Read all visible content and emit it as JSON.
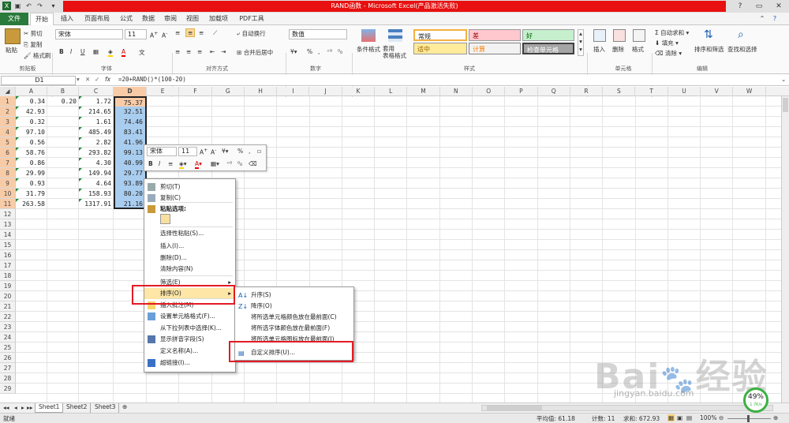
{
  "window": {
    "title": "RAND函数 - Microsoft Excel(产品激活失败)"
  },
  "tabs": [
    "文件",
    "开始",
    "插入",
    "页面布局",
    "公式",
    "数据",
    "审阅",
    "视图",
    "加载项",
    "PDF工具"
  ],
  "ribbon": {
    "clipboard": {
      "paste": "粘贴",
      "cut": "剪切",
      "copy": "复制",
      "format_painter": "格式刷",
      "group": "剪贴板"
    },
    "font": {
      "name": "宋体",
      "size": "11",
      "group": "字体"
    },
    "alignment": {
      "wrap": "自动换行",
      "merge": "合并后居中",
      "group": "对齐方式"
    },
    "number": {
      "format": "数值",
      "group": "数字"
    },
    "styles": {
      "conditional": "条件格式",
      "table": "套用\n表格格式",
      "normal": "常规",
      "bad": "差",
      "good": "好",
      "neutral": "适中",
      "calc": "计算",
      "check": "检查单元格",
      "group": "样式"
    },
    "cells": {
      "insert": "插入",
      "delete": "删除",
      "format": "格式",
      "group": "单元格"
    },
    "editing": {
      "autosum": "自动求和",
      "fill": "填充",
      "clear": "清除",
      "sort_filter": "排序和筛选",
      "find_select": "查找和选择",
      "group": "编辑"
    }
  },
  "formula_bar": {
    "name_box": "D1",
    "fx": "fx",
    "formula": "=20+RAND()*(100-20)"
  },
  "columns": [
    "A",
    "B",
    "C",
    "D",
    "E",
    "F",
    "G",
    "H",
    "I",
    "J",
    "K",
    "L",
    "M",
    "N",
    "O",
    "P",
    "Q",
    "R",
    "S",
    "T",
    "U",
    "V",
    "W"
  ],
  "rows": [
    "1",
    "2",
    "3",
    "4",
    "5",
    "6",
    "7",
    "8",
    "9",
    "10",
    "11",
    "12",
    "13",
    "14",
    "15",
    "16",
    "17",
    "18",
    "19",
    "20",
    "21",
    "22",
    "23",
    "24",
    "25",
    "26",
    "27",
    "28",
    "29"
  ],
  "cells": {
    "A": [
      "0.34",
      "42.93",
      "0.32",
      "97.10",
      "0.56",
      "58.76",
      "0.86",
      "29.99",
      "0.93",
      "31.79",
      "263.58"
    ],
    "B": [
      "0.20"
    ],
    "C": [
      "1.72",
      "214.65",
      "1.61",
      "485.49",
      "2.82",
      "293.82",
      "4.30",
      "149.94",
      "4.64",
      "158.93",
      "1317.91"
    ],
    "D": [
      "75.37",
      "32.51",
      "74.46",
      "83.41",
      "41.96",
      "99.13",
      "40.99",
      "29.77",
      "93.89",
      "80.20",
      "21.16"
    ]
  },
  "mini_toolbar": {
    "font": "宋体",
    "size": "11"
  },
  "context_menu": [
    {
      "label": "剪切(T)",
      "icon": "scissors-icon"
    },
    {
      "label": "复制(C)",
      "icon": "copy-icon"
    },
    {
      "label": "粘贴选项:",
      "icon": "paste-icon",
      "bold": true
    },
    {
      "label": "",
      "icon": "paste-option-icon"
    },
    {
      "label": "选择性粘贴(S)...",
      "icon": ""
    },
    {
      "label": "插入(I)...",
      "icon": ""
    },
    {
      "label": "删除(D)...",
      "icon": ""
    },
    {
      "label": "清除内容(N)",
      "icon": ""
    },
    {
      "label": "筛选(E)",
      "icon": "",
      "arrow": true
    },
    {
      "label": "排序(O)",
      "icon": "",
      "arrow": true,
      "highlight": true
    },
    {
      "label": "插入批注(M)",
      "icon": "comment-icon"
    },
    {
      "label": "设置单元格格式(F)...",
      "icon": "format-cells-icon"
    },
    {
      "label": "从下拉列表中选择(K)...",
      "icon": ""
    },
    {
      "label": "显示拼音字段(S)",
      "icon": "pinyin-icon"
    },
    {
      "label": "定义名称(A)...",
      "icon": ""
    },
    {
      "label": "超链接(I)...",
      "icon": "hyperlink-icon"
    }
  ],
  "sort_submenu": [
    {
      "label": "升序(S)",
      "icon": "sort-asc-icon"
    },
    {
      "label": "降序(O)",
      "icon": "sort-desc-icon"
    },
    {
      "label": "将所选单元格颜色放在最前面(C)",
      "icon": ""
    },
    {
      "label": "将所选字体颜色放在最前面(F)",
      "icon": ""
    },
    {
      "label": "将所选单元格图标放在最前面(I)",
      "icon": ""
    },
    {
      "label": "自定义排序(U)...",
      "icon": "custom-sort-icon"
    }
  ],
  "sheets": [
    "Sheet1",
    "Sheet2",
    "Sheet3"
  ],
  "status": {
    "ready": "就绪",
    "average": "平均值: 61.18",
    "count": "计数: 11",
    "sum": "求和: 672.93",
    "zoom": "100%"
  },
  "watermark": {
    "brand": "Bai",
    "brand2": "经验",
    "url": "jingyan.baidu.com"
  },
  "gauge": {
    "percent": "49%",
    "rate": "1.7K/s"
  },
  "colors": {
    "file_tab": "#2a7a3b",
    "title_red": "#e81010",
    "highlight": "#e31b23",
    "selection": "#f8cba7"
  }
}
